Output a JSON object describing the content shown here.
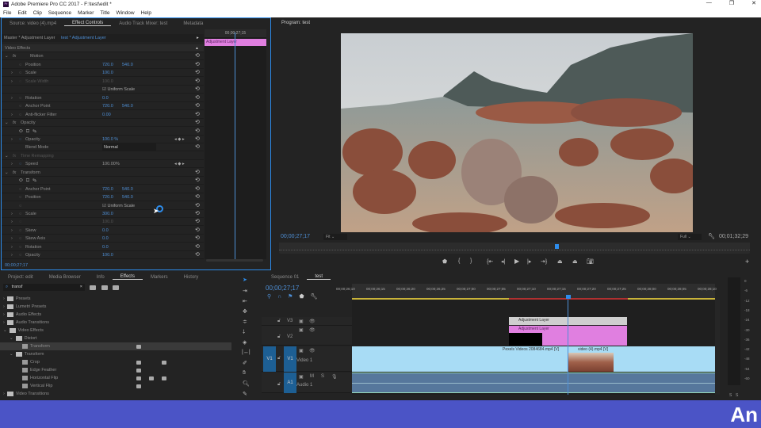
{
  "app": {
    "title": "Adobe Premiere Pro CC 2017 - F:\\test\\edit *",
    "window_buttons": [
      "—",
      "❐",
      "✕"
    ]
  },
  "menu": [
    "File",
    "Edit",
    "Clip",
    "Sequence",
    "Marker",
    "Title",
    "Window",
    "Help"
  ],
  "effect_controls": {
    "tabs": [
      "Source: video (4).mp4",
      "Effect Controls",
      "Audio Track Mixer: test",
      "Metadata"
    ],
    "master": "Master * Adjustment Layer",
    "clip": "test * Adjustment Layer",
    "mini_timecode": "00;00;27;15",
    "mini_clip": "Adjustment Layer",
    "rows": [
      {
        "label": "Video Effects",
        "head": true
      },
      {
        "label": "Motion",
        "fx": true
      },
      {
        "label": "Position",
        "v1": "720.0",
        "v2": "540.0",
        "sw": true
      },
      {
        "label": "Scale",
        "v1": "100.0",
        "sw": true,
        "exp": true
      },
      {
        "label": "Scale Width",
        "v1": "100.0",
        "sw": true,
        "exp": true,
        "dim": true
      },
      {
        "label": "",
        "check": "Uniform Scale"
      },
      {
        "label": "Rotation",
        "v1": "0.0",
        "sw": true,
        "exp": true
      },
      {
        "label": "Anchor Point",
        "v1": "720.0",
        "v2": "540.0",
        "sw": true
      },
      {
        "label": "Anti-flicker Filter",
        "v1": "0.00",
        "sw": true,
        "exp": true
      },
      {
        "label": "Opacity",
        "fx": true
      },
      {
        "label": "",
        "masks": true
      },
      {
        "label": "Opacity",
        "v1": "100.0 %",
        "sw": true,
        "exp": true,
        "kf": true
      },
      {
        "label": "Blend Mode",
        "v1": "Normal",
        "select": true
      },
      {
        "label": "Time Remapping",
        "fx": true,
        "dim": true
      },
      {
        "label": "Speed",
        "v1": "100.00%",
        "sw": true,
        "exp": true,
        "kf": true,
        "grey": true
      },
      {
        "label": "Transform",
        "fx": true
      },
      {
        "label": "",
        "masks": true
      },
      {
        "label": "Anchor Point",
        "v1": "720.0",
        "v2": "540.0",
        "sw": true
      },
      {
        "label": "Position",
        "v1": "720.0",
        "v2": "540.0",
        "sw": true
      },
      {
        "label": "",
        "check": "Uniform Scale",
        "sw": true
      },
      {
        "label": "Scale",
        "v1": "300.0",
        "sw": true,
        "exp": true
      },
      {
        "label": "",
        "v1": "100.0",
        "sw": true,
        "exp": true,
        "dim": true
      },
      {
        "label": "Skew",
        "v1": "0.0",
        "sw": true,
        "exp": true
      },
      {
        "label": "Skew Axis",
        "v1": "0.0",
        "sw": true,
        "exp": true
      },
      {
        "label": "Rotation",
        "v1": "0.0",
        "sw": true,
        "exp": true
      },
      {
        "label": "Opacity",
        "v1": "100.0",
        "sw": true,
        "exp": true
      }
    ],
    "timecode": "00;00;27;17"
  },
  "program": {
    "title": "Program: test",
    "timecode": "00;00;27;17",
    "fit": "Fit",
    "quality": "Full",
    "duration": "00;01;32;29",
    "playhead_fraction": 0.3
  },
  "project": {
    "tabs": [
      "Project: edit",
      "Media Browser",
      "Info",
      "Effects",
      "Markers",
      "History"
    ],
    "search": "transf",
    "items": [
      {
        "label": "Presets",
        "lvl": 0,
        "exp": "›"
      },
      {
        "label": "Lumetri Presets",
        "lvl": 0,
        "exp": "›"
      },
      {
        "label": "Audio Effects",
        "lvl": 0,
        "exp": "›"
      },
      {
        "label": "Audio Transitions",
        "lvl": 0,
        "exp": "›"
      },
      {
        "label": "Video Effects",
        "lvl": 0,
        "exp": "⌄"
      },
      {
        "label": "Distort",
        "lvl": 1,
        "exp": "⌄"
      },
      {
        "label": "Transform",
        "lvl": 2,
        "fx": true,
        "sel": true,
        "b": [
          1
        ]
      },
      {
        "label": "Transform",
        "lvl": 1,
        "exp": "⌄"
      },
      {
        "label": "Crop",
        "lvl": 2,
        "fx": true,
        "b": [
          1,
          3
        ]
      },
      {
        "label": "Edge Feather",
        "lvl": 2,
        "fx": true,
        "b": [
          1
        ]
      },
      {
        "label": "Horizontal Flip",
        "lvl": 2,
        "fx": true,
        "b": [
          1,
          2,
          3
        ]
      },
      {
        "label": "Vertical Flip",
        "lvl": 2,
        "fx": true,
        "b": [
          1
        ]
      },
      {
        "label": "Video Transitions",
        "lvl": 0,
        "exp": "›"
      }
    ]
  },
  "timeline": {
    "tabs": [
      "Sequence 01",
      "test"
    ],
    "timecode": "00;00;27;17",
    "ruler": [
      "00;00;26;10",
      "00;00;26;15",
      "00;00;26;20",
      "00;00;26;25",
      "00;00;27;00",
      "00;00;27;05",
      "00;00;27;10",
      "00;00;27;15",
      "00;00;27;20",
      "00;00;27;25",
      "00;00;28;00",
      "00;00;28;05",
      "00;00;28;10"
    ],
    "tracks": {
      "v3": "V3",
      "v2": "V2",
      "v1": "V1",
      "v1name": "Video 1",
      "a1": "A1",
      "a1name": "Audio 1",
      "m": "M",
      "s": "S"
    },
    "clips": {
      "adj1": "Adjustment Layer",
      "adj2": "Adjustment Layer",
      "pexels": "Pexels Videos 2084684.mp4 [V]",
      "video4": "video (4).mp4 [V]"
    },
    "meter": [
      "0",
      "-6",
      "-12",
      "-18",
      "-24",
      "-30",
      "-36",
      "-42",
      "-48",
      "-54",
      "-60"
    ],
    "solo": [
      "S",
      "S"
    ]
  },
  "logo": "An",
  "colors": {
    "accent": "#2d8ceb",
    "pink": "#e07fe0",
    "video_clip": "#a8dcf5",
    "audio_clip": "#5a7aa0",
    "band": "#4b54c6"
  }
}
